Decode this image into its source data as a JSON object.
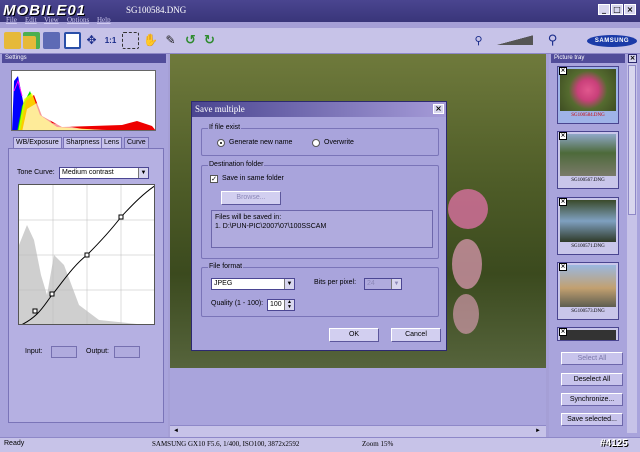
{
  "window": {
    "brand": "MOBILE01",
    "title": "SG100584.DNG"
  },
  "menu": [
    "File",
    "Edit",
    "View",
    "Options",
    "Help"
  ],
  "panels": {
    "settings_title": "Settings",
    "tray_title": "Picture tray"
  },
  "tabs": [
    "WB/Exposure",
    "Sharpness",
    "Lens",
    "Curve"
  ],
  "curve": {
    "label": "Tone Curve:",
    "value": "Medium contrast",
    "input_label": "Input:",
    "output_label": "Output:"
  },
  "brand_logo": "SAMSUNG",
  "dialog": {
    "title": "Save multiple",
    "if_exist_group": "If file exist",
    "generate_new": "Generate new name",
    "overwrite": "Overwrite",
    "destination_group": "Destination folder",
    "same_folder": "Save in same folder",
    "browse": "Browse...",
    "files_saved_in": "Files will be saved in:",
    "path": "1. D:\\PUN-PIC\\2007\\07\\100SSCAM",
    "format_group": "File format",
    "format_value": "JPEG",
    "bits_label": "Bits per pixel:",
    "bits_value": "24",
    "quality_label": "Quality (1 - 100):",
    "quality_value": "100",
    "ok": "OK",
    "cancel": "Cancel"
  },
  "tray": {
    "thumbs": [
      "SG100584.DNG",
      "SG100567.DNG",
      "SG100571.DNG",
      "SG100573.DNG"
    ],
    "select_all": "Select All",
    "deselect_all": "Deselect All",
    "synchronize": "Synchronize...",
    "save_selected": "Save selected..."
  },
  "status": {
    "state": "Ready",
    "camera": "SAMSUNG GX10",
    "exposure": "F5.6, 1/400, ISO100, 3872x2592",
    "zoom": "Zoom 15%",
    "watermark": "#4125"
  },
  "colors": {
    "accent": "#4a4590",
    "panel": "#a9a4dc",
    "selected_name": "#cc0000"
  }
}
